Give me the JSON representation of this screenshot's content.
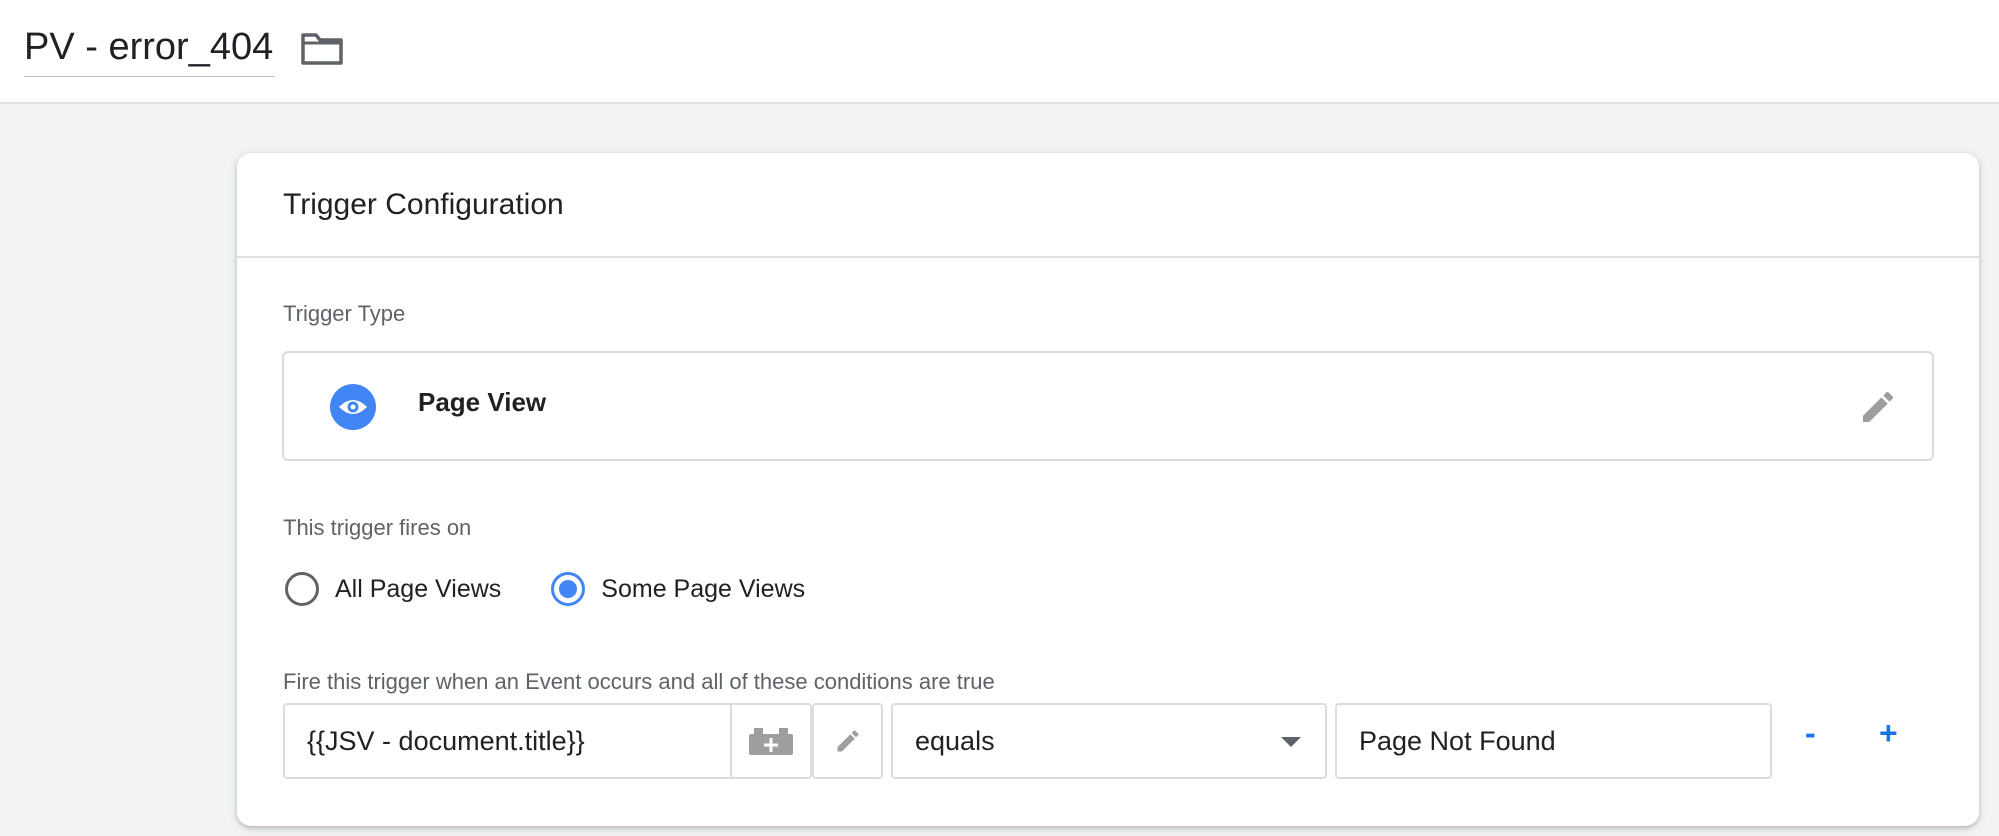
{
  "header": {
    "trigger_name": "PV - error_404",
    "folder_icon": "folder-icon"
  },
  "card": {
    "title": "Trigger Configuration",
    "trigger_type_label": "Trigger Type",
    "trigger_type": {
      "name": "Page View",
      "icon": "eye-icon",
      "icon_color": "#4285f4"
    },
    "fires_on_label": "This trigger fires on",
    "fires_on_options": [
      {
        "label": "All Page Views",
        "selected": false
      },
      {
        "label": "Some Page Views",
        "selected": true
      }
    ],
    "conditions_label": "Fire this trigger when an Event occurs and all of these conditions are true",
    "condition": {
      "variable": "{{JSV - document.title}}",
      "operator": "equals",
      "value": "Page Not Found",
      "remove_label": "-",
      "add_label": "+"
    }
  },
  "colors": {
    "accent": "#1a73e8",
    "background": "#f1f3f4"
  }
}
